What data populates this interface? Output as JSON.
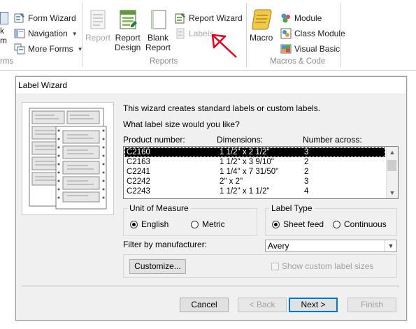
{
  "ribbon": {
    "forms": {
      "form_wizard": "Form Wizard",
      "navigation": "Navigation",
      "more_forms": "More Forms",
      "cut_labels": [
        "k",
        "m"
      ],
      "group_label": "rms"
    },
    "reports": {
      "report": "Report",
      "report_design": [
        "Report",
        "Design"
      ],
      "blank_report": [
        "Blank",
        "Report"
      ],
      "report_wizard": "Report Wizard",
      "labels": "Labels",
      "group_label": "Reports"
    },
    "macros": {
      "macro": "Macro",
      "module": "Module",
      "class_module": "Class Module",
      "visual_basic": "Visual Basic",
      "group_label": "Macros & Code"
    },
    "annotation_color": "#e8001c"
  },
  "dialog": {
    "title": "Label Wizard",
    "intro": "This wizard creates standard labels or custom labels.",
    "question": "What label size would you like?",
    "columns": {
      "product": "Product number:",
      "dimensions": "Dimensions:",
      "across": "Number across:"
    },
    "rows": [
      {
        "product": "C2160",
        "dimensions": "1 1/2\" x 2 1/2\"",
        "across": "3"
      },
      {
        "product": "C2163",
        "dimensions": "1 1/2\" x 3 9/10\"",
        "across": "2"
      },
      {
        "product": "C2241",
        "dimensions": "1 1/4\" x 7 31/50\"",
        "across": "2"
      },
      {
        "product": "C2242",
        "dimensions": "2\" x 2\"",
        "across": "3"
      },
      {
        "product": "C2243",
        "dimensions": "1 1/2\" x 1 1/2\"",
        "across": "4"
      }
    ],
    "unit_of_measure": {
      "title": "Unit of Measure",
      "english": "English",
      "metric": "Metric",
      "selected": "English"
    },
    "label_type": {
      "title": "Label Type",
      "sheet_feed": "Sheet feed",
      "continuous": "Continuous",
      "selected": "Sheet feed"
    },
    "filter_label": "Filter by  manufacturer:",
    "manufacturer": "Avery",
    "customize": "Customize...",
    "show_custom": "Show custom label sizes",
    "buttons": {
      "cancel": "Cancel",
      "back": "< Back",
      "next": "Next >",
      "finish": "Finish"
    }
  }
}
